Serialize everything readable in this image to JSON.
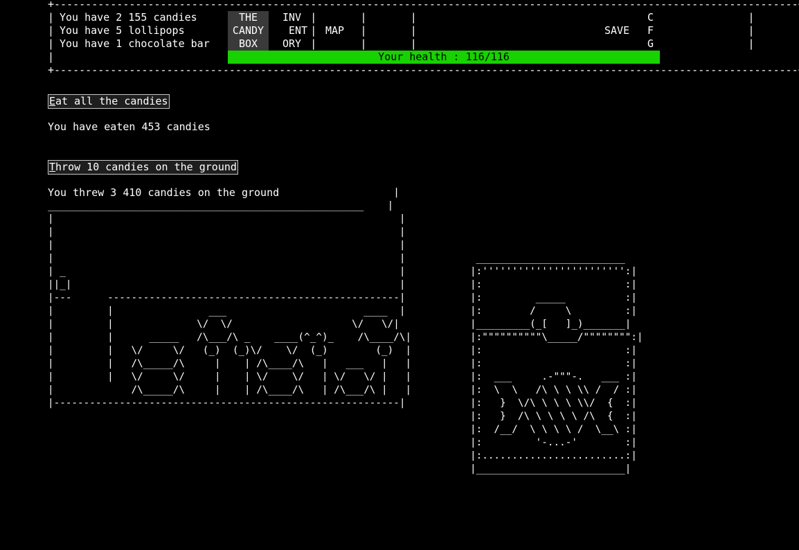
{
  "inventory": {
    "candies": "You have 2 155 candies",
    "lollipops": "You have 5 lollipops",
    "chocolate": "You have 1 chocolate bar"
  },
  "tabs": {
    "candy_box": [
      "THE",
      "CANDY",
      "BOX"
    ],
    "inventory": [
      "INV",
      "ENT",
      "ORY"
    ],
    "map": "MAP",
    "save": "SAVE",
    "cfg": [
      "C",
      "F",
      "G"
    ]
  },
  "health": {
    "text": "Your health : 116/116",
    "current": 116,
    "max": 116,
    "bar_color": "#17d100"
  },
  "actions": {
    "eat_button": "Eat all the candies",
    "eat_first": "E",
    "eat_rest": "at all the candies",
    "eaten_text": "You have eaten 453 candies",
    "throw_button": "Throw 10 candies on the ground",
    "throw_first": "T",
    "throw_rest": "hrow 10 candies on the ground",
    "thrown_text": "You threw 3 410 candies on the ground"
  },
  "colors": {
    "background": "#000000",
    "text": "#ffffff",
    "active_tab": "#3a3a3a",
    "health": "#17d100"
  }
}
